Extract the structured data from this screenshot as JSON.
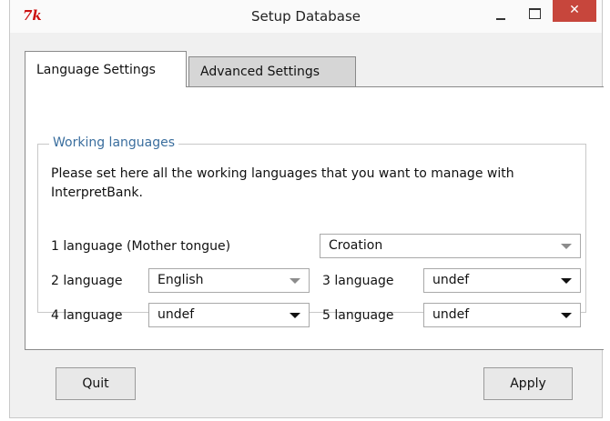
{
  "window": {
    "title": "Setup Database",
    "app_icon": "tk-icon",
    "app_icon_text": "7k",
    "close_glyph": "✕"
  },
  "tabs": [
    {
      "label": "Language Settings",
      "active": true
    },
    {
      "label": "Advanced Settings",
      "active": false
    }
  ],
  "group": {
    "legend": "Working languages",
    "instruction": "Please set here all the working languages that you want to manage with InterpretBank."
  },
  "languages": {
    "lang1": {
      "label": "1 language (Mother tongue)",
      "value": "Croation"
    },
    "lang2": {
      "label": "2 language",
      "value": "English"
    },
    "lang3": {
      "label": "3 language",
      "value": "undef"
    },
    "lang4": {
      "label": "4 language",
      "value": "undef"
    },
    "lang5": {
      "label": "5 language",
      "value": "undef"
    }
  },
  "buttons": {
    "quit": "Quit",
    "apply": "Apply"
  },
  "colors": {
    "close_button": "#c7463c",
    "legend_text": "#3a6e9e",
    "active_tab": "#ffffff",
    "inactive_tab": "#d6d6d6"
  }
}
